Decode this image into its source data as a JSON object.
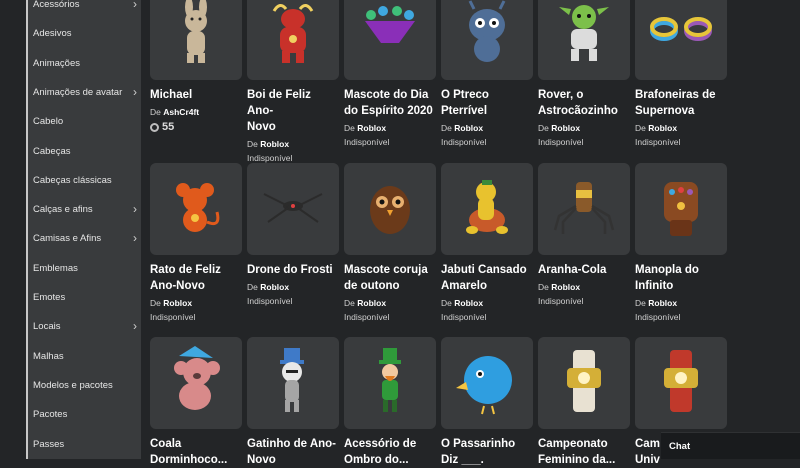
{
  "sidebar": {
    "items": [
      {
        "label": "Acessórios",
        "chevron": true
      },
      {
        "label": "Adesivos",
        "chevron": false
      },
      {
        "label": "Animações",
        "chevron": false
      },
      {
        "label": "Animações de avatar",
        "chevron": true
      },
      {
        "label": "Cabelo",
        "chevron": false
      },
      {
        "label": "Cabeças",
        "chevron": false
      },
      {
        "label": "Cabeças clássicas",
        "chevron": false
      },
      {
        "label": "Calças e afins",
        "chevron": true
      },
      {
        "label": "Camisas e Afins",
        "chevron": true
      },
      {
        "label": "Emblemas",
        "chevron": false
      },
      {
        "label": "Emotes",
        "chevron": false
      },
      {
        "label": "Locais",
        "chevron": true
      },
      {
        "label": "Malhas",
        "chevron": false
      },
      {
        "label": "Modelos e pacotes",
        "chevron": false
      },
      {
        "label": "Pacotes",
        "chevron": false
      },
      {
        "label": "Passes",
        "chevron": false
      }
    ]
  },
  "catalog": {
    "creator_prefix": "De",
    "items": [
      {
        "name_l1": "Michael",
        "name_l2": "",
        "creator": "AshCr4ft",
        "status": "",
        "price": "55",
        "icon": "bunny-icon",
        "color": "#c9b79a"
      },
      {
        "name_l1": "Boi de Feliz Ano-",
        "name_l2": "Novo",
        "creator": "Roblox",
        "status": "Indisponível",
        "price": "",
        "icon": "ox-icon",
        "color": "#c8312a"
      },
      {
        "name_l1": "Mascote do Dia",
        "name_l2": "do Espírito 2020",
        "creator": "Roblox",
        "status": "Indisponível",
        "price": "",
        "icon": "spirit-mascot-icon",
        "color": "#8a2fb8"
      },
      {
        "name_l1": "O Ptreco",
        "name_l2": "Pterrível",
        "creator": "Roblox",
        "status": "Indisponível",
        "price": "",
        "icon": "monster-icon",
        "color": "#4f6e97"
      },
      {
        "name_l1": "Rover, o",
        "name_l2": "Astrocãozinho",
        "creator": "Roblox",
        "status": "Indisponível",
        "price": "",
        "icon": "space-dog-icon",
        "color": "#7cc04a"
      },
      {
        "name_l1": "Brafoneiras de",
        "name_l2": "Supernova",
        "creator": "Roblox",
        "status": "Indisponível",
        "price": "",
        "icon": "bracelets-icon",
        "color": "#e7c63a"
      },
      {
        "name_l1": "Rato de Feliz",
        "name_l2": "Ano-Novo",
        "creator": "Roblox",
        "status": "Indisponível",
        "price": "",
        "icon": "rat-icon",
        "color": "#e05a1c"
      },
      {
        "name_l1": "Drone do Frosti",
        "name_l2": "",
        "creator": "Roblox",
        "status": "Indisponível",
        "price": "",
        "icon": "drone-icon",
        "color": "#2b2b2b"
      },
      {
        "name_l1": "Mascote coruja",
        "name_l2": "de outono",
        "creator": "Roblox",
        "status": "Indisponível",
        "price": "",
        "icon": "owl-icon",
        "color": "#6b3a1a"
      },
      {
        "name_l1": "Jabuti Cansado",
        "name_l2": "Amarelo",
        "creator": "Roblox",
        "status": "Indisponível",
        "price": "",
        "icon": "turtle-icon",
        "color": "#e8c22e"
      },
      {
        "name_l1": "Aranha-Cola",
        "name_l2": "",
        "creator": "Roblox",
        "status": "Indisponível",
        "price": "",
        "icon": "spider-icon",
        "color": "#8a5a2a"
      },
      {
        "name_l1": "Manopla do",
        "name_l2": "Infinito",
        "creator": "Roblox",
        "status": "Indisponível",
        "price": "",
        "icon": "gauntlet-icon",
        "color": "#8a4a22"
      },
      {
        "name_l1": "Coala",
        "name_l2": "Dorminhoco...",
        "creator": "",
        "status": "",
        "price": "",
        "icon": "koala-icon",
        "color": "#d88a8a"
      },
      {
        "name_l1": "Gatinho de Ano-",
        "name_l2": "Novo",
        "creator": "",
        "status": "",
        "price": "",
        "icon": "kitten-icon",
        "color": "#a5a5a5"
      },
      {
        "name_l1": "Acessório de",
        "name_l2": "Ombro do...",
        "creator": "",
        "status": "",
        "price": "",
        "icon": "leprechaun-icon",
        "color": "#2f9a3a"
      },
      {
        "name_l1": "O Passarinho",
        "name_l2": "Diz ___.",
        "creator": "",
        "status": "",
        "price": "",
        "icon": "bird-icon",
        "color": "#2f9ee0"
      },
      {
        "name_l1": "Campeonato",
        "name_l2": "Feminino da...",
        "creator": "",
        "status": "",
        "price": "",
        "icon": "championship-belt-icon",
        "color": "#e8e1d2"
      },
      {
        "name_l1": "Cam",
        "name_l2": "Univ",
        "creator": "",
        "status": "",
        "price": "",
        "icon": "championship-belt-icon",
        "color": "#c0392b"
      }
    ]
  },
  "chat": {
    "label": "Chat"
  }
}
